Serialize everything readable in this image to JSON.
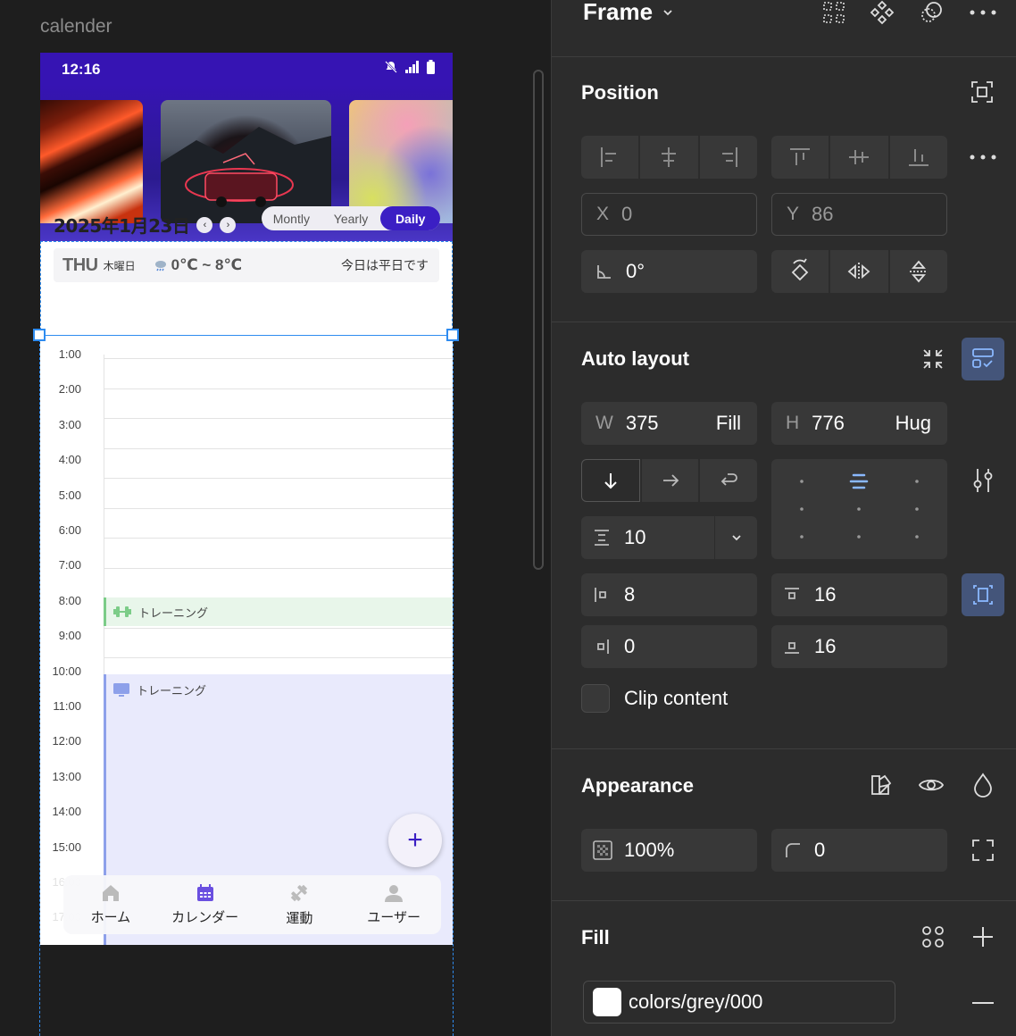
{
  "canvas": {
    "frame_label": "calender",
    "status_time": "12:16",
    "date_text": "2025年1月23日",
    "prev_arrow": "‹",
    "next_arrow": "›",
    "view_tabs": [
      "Montly",
      "Yearly",
      "Daily"
    ],
    "active_tab": "Daily",
    "day_abbr": "THU",
    "weekday": "木曜日",
    "weather_text": "0℃ ~ 8℃",
    "holiday_text": "今日は平日です",
    "hours": [
      "1:00",
      "2:00",
      "3:00",
      "4:00",
      "5:00",
      "6:00",
      "7:00",
      "8:00",
      "9:00",
      "10:00",
      "11:00",
      "12:00",
      "13:00",
      "14:00",
      "15:00",
      "16:00",
      "17:00"
    ],
    "event1_label": "トレーニング",
    "event2_label": "トレーニング",
    "fab_symbol": "+",
    "nav": [
      "ホーム",
      "カレンダー",
      "運動",
      "ユーザー"
    ]
  },
  "panel": {
    "frame_title": "Frame",
    "position_title": "Position",
    "x_label": "X",
    "x_value": "0",
    "y_label": "Y",
    "y_value": "86",
    "rotation_value": "0°",
    "autolayout_title": "Auto layout",
    "w_label": "W",
    "w_value": "375",
    "w_mode": "Fill",
    "h_label": "H",
    "h_value": "776",
    "h_mode": "Hug",
    "gap_value": "10",
    "pad_left": "8",
    "pad_top": "16",
    "pad_right": "0",
    "pad_bottom": "16",
    "clip_label": "Clip content",
    "appearance_title": "Appearance",
    "opacity_value": "100%",
    "radius_value": "0",
    "fill_title": "Fill",
    "fill_style": "colors/grey/000"
  },
  "colors": {
    "brand": "#3614b3",
    "active_tab": "#3b1fc4",
    "selection": "#2f8cf0",
    "event_green": "#e8f6ea",
    "event_blue": "#e9eafc"
  }
}
